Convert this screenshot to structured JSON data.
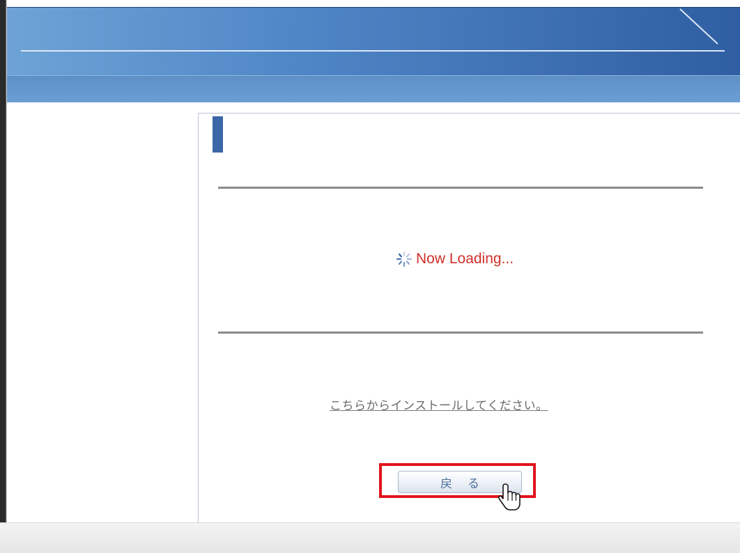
{
  "loading": {
    "text": "Now Loading...",
    "icon": "spinner-icon",
    "color": "#d0302a"
  },
  "install_link": {
    "text": "こちらからインストールしてください。"
  },
  "back_button": {
    "label": "戻る"
  },
  "colors": {
    "header_dark": "#2f5ea3",
    "header_light": "#6ea3d6",
    "accent": "#3b66a8",
    "highlight": "#e0141c"
  },
  "cursor": {
    "icon": "hand-pointer-icon"
  }
}
